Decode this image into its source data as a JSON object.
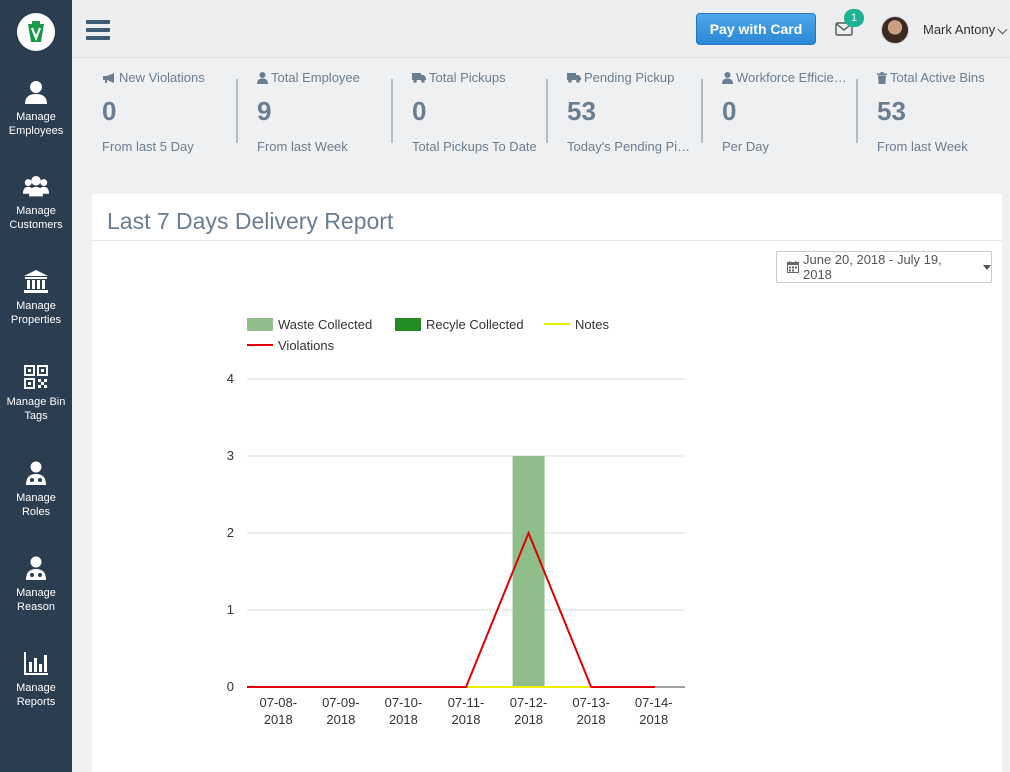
{
  "sidebar": {
    "items": [
      {
        "label": "Manage Employees",
        "icon": "user-icon"
      },
      {
        "label": "Manage Customers",
        "icon": "users-icon"
      },
      {
        "label": "Manage Properties",
        "icon": "bank-icon"
      },
      {
        "label": "Manage Bin Tags",
        "icon": "qrcode-icon"
      },
      {
        "label": "Manage Roles",
        "icon": "user-md-icon"
      },
      {
        "label": "Manage Reason",
        "icon": "user-md-icon"
      },
      {
        "label": "Manage Reports",
        "icon": "bar-chart-icon"
      }
    ]
  },
  "topbar": {
    "pay_button": "Pay with Card",
    "notification_count": "1",
    "user_name": "Mark Antony"
  },
  "stats": [
    {
      "title": "New Violations",
      "icon": "bullhorn-icon",
      "value": "0",
      "subtitle": "From last 5 Day"
    },
    {
      "title": "Total Employee",
      "icon": "user-icon",
      "value": "9",
      "subtitle": "From last Week"
    },
    {
      "title": "Total Pickups",
      "icon": "truck-icon",
      "value": "0",
      "subtitle": "Total Pickups To Date"
    },
    {
      "title": "Pending Pickup",
      "icon": "truck-icon",
      "value": "53",
      "subtitle": "Today's Pending Pickups"
    },
    {
      "title": "Workforce Efficiency",
      "icon": "user-icon",
      "value": "0",
      "subtitle": "Per Day"
    },
    {
      "title": "Total Active Bins",
      "icon": "trash-icon",
      "value": "53",
      "subtitle": "From last Week"
    }
  ],
  "report": {
    "title": "Last 7 Days Delivery Report",
    "date_range": "June 20, 2018 - July 19, 2018"
  },
  "colors": {
    "sidebar": "#2b3d51",
    "accent": "#2b86d6",
    "badge": "#1ab394",
    "waste": "#8fbe8b",
    "recycle": "#228b22",
    "notes": "#f0f000",
    "violations": "#e00000"
  },
  "chart_data": {
    "type": "bar",
    "categories": [
      "07-08-2018",
      "07-09-2018",
      "07-10-2018",
      "07-11-2018",
      "07-12-2018",
      "07-13-2018",
      "07-14-2018"
    ],
    "ylim": [
      0,
      4
    ],
    "yticks": [
      0,
      1,
      2,
      3,
      4
    ],
    "legend_position": "top-left",
    "grid": true,
    "series": [
      {
        "name": "Waste Collected",
        "kind": "bar",
        "color": "#8fbe8b",
        "values": [
          0,
          0,
          0,
          0,
          3,
          0,
          0
        ]
      },
      {
        "name": "Recyle Collected",
        "kind": "bar",
        "color": "#228b22",
        "values": [
          0,
          0,
          0,
          0,
          0,
          0,
          0
        ]
      },
      {
        "name": "Notes",
        "kind": "line",
        "color": "#f0f000",
        "values": [
          0,
          0,
          0,
          0,
          0,
          0,
          0
        ]
      },
      {
        "name": "Violations",
        "kind": "line",
        "color": "#e00000",
        "values": [
          0,
          0,
          0,
          0,
          2,
          0,
          0
        ]
      }
    ]
  }
}
